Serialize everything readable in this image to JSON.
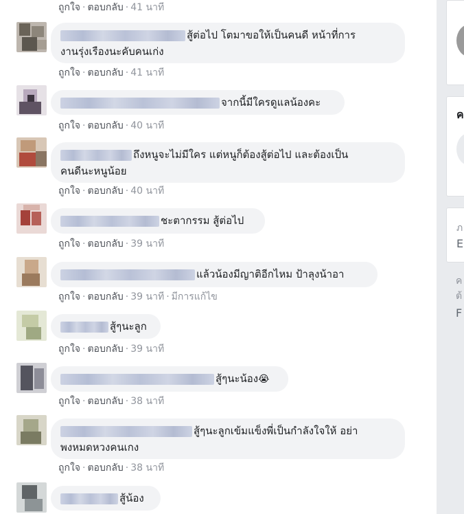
{
  "labels": {
    "like": "ถูกใจ",
    "reply": "ตอบกลับ",
    "edited": "มีการแก้ไข"
  },
  "comments": [
    {
      "line1": "",
      "line2": "",
      "time": "41 นาที"
    },
    {
      "line1": "สู้ต่อไป โตมาขอให้เป็นคนดี หน้าที่การ",
      "line2": "งานรุ่งเรืองนะคับคนเก่ง",
      "time": "41 นาที"
    },
    {
      "line1": "จากนี้มีใครดูแลน้องคะ",
      "line2": "",
      "time": "40 นาที"
    },
    {
      "line1": "ถึงหนูจะไม่มีใคร แต่หนูก็ต้องสู้ต่อไป และต้องเป็น",
      "line2": "คนดีนะหนูน้อย",
      "time": "40 นาที"
    },
    {
      "line1": "ชะตากรรม สู้ต่อไป",
      "line2": "",
      "time": "39 นาที"
    },
    {
      "line1": "แล้วน้องมีญาติอีกไหม ป้าลุงน้าอา",
      "line2": "",
      "time": "39 นาที",
      "edited": true
    },
    {
      "line1": "สู้ๆนะลูก",
      "line2": "",
      "time": "39 นาที"
    },
    {
      "line1": "สู้ๆนะน้อง",
      "line2": "",
      "emoji": "😭",
      "time": "38 นาที"
    },
    {
      "line1": "สู้ๆนะลูกเข้มแข็งพี่เป็นกำลังใจให้ อย่า",
      "line2": "พงหมดหวงคนเกง",
      "time": "38 นาที"
    },
    {
      "line1": "สู้น้อง",
      "line2": "",
      "time": ""
    }
  ],
  "sidebar": {
    "t1": "ค",
    "t2": "ภ",
    "t3": "E",
    "t4": "ค",
    "t5": "ต้",
    "t6": "F"
  },
  "colors": {
    "bubble": "#f2f3f5",
    "page_bg": "#e9ebee",
    "meta": "#90949c",
    "link": "#4b4f56"
  }
}
